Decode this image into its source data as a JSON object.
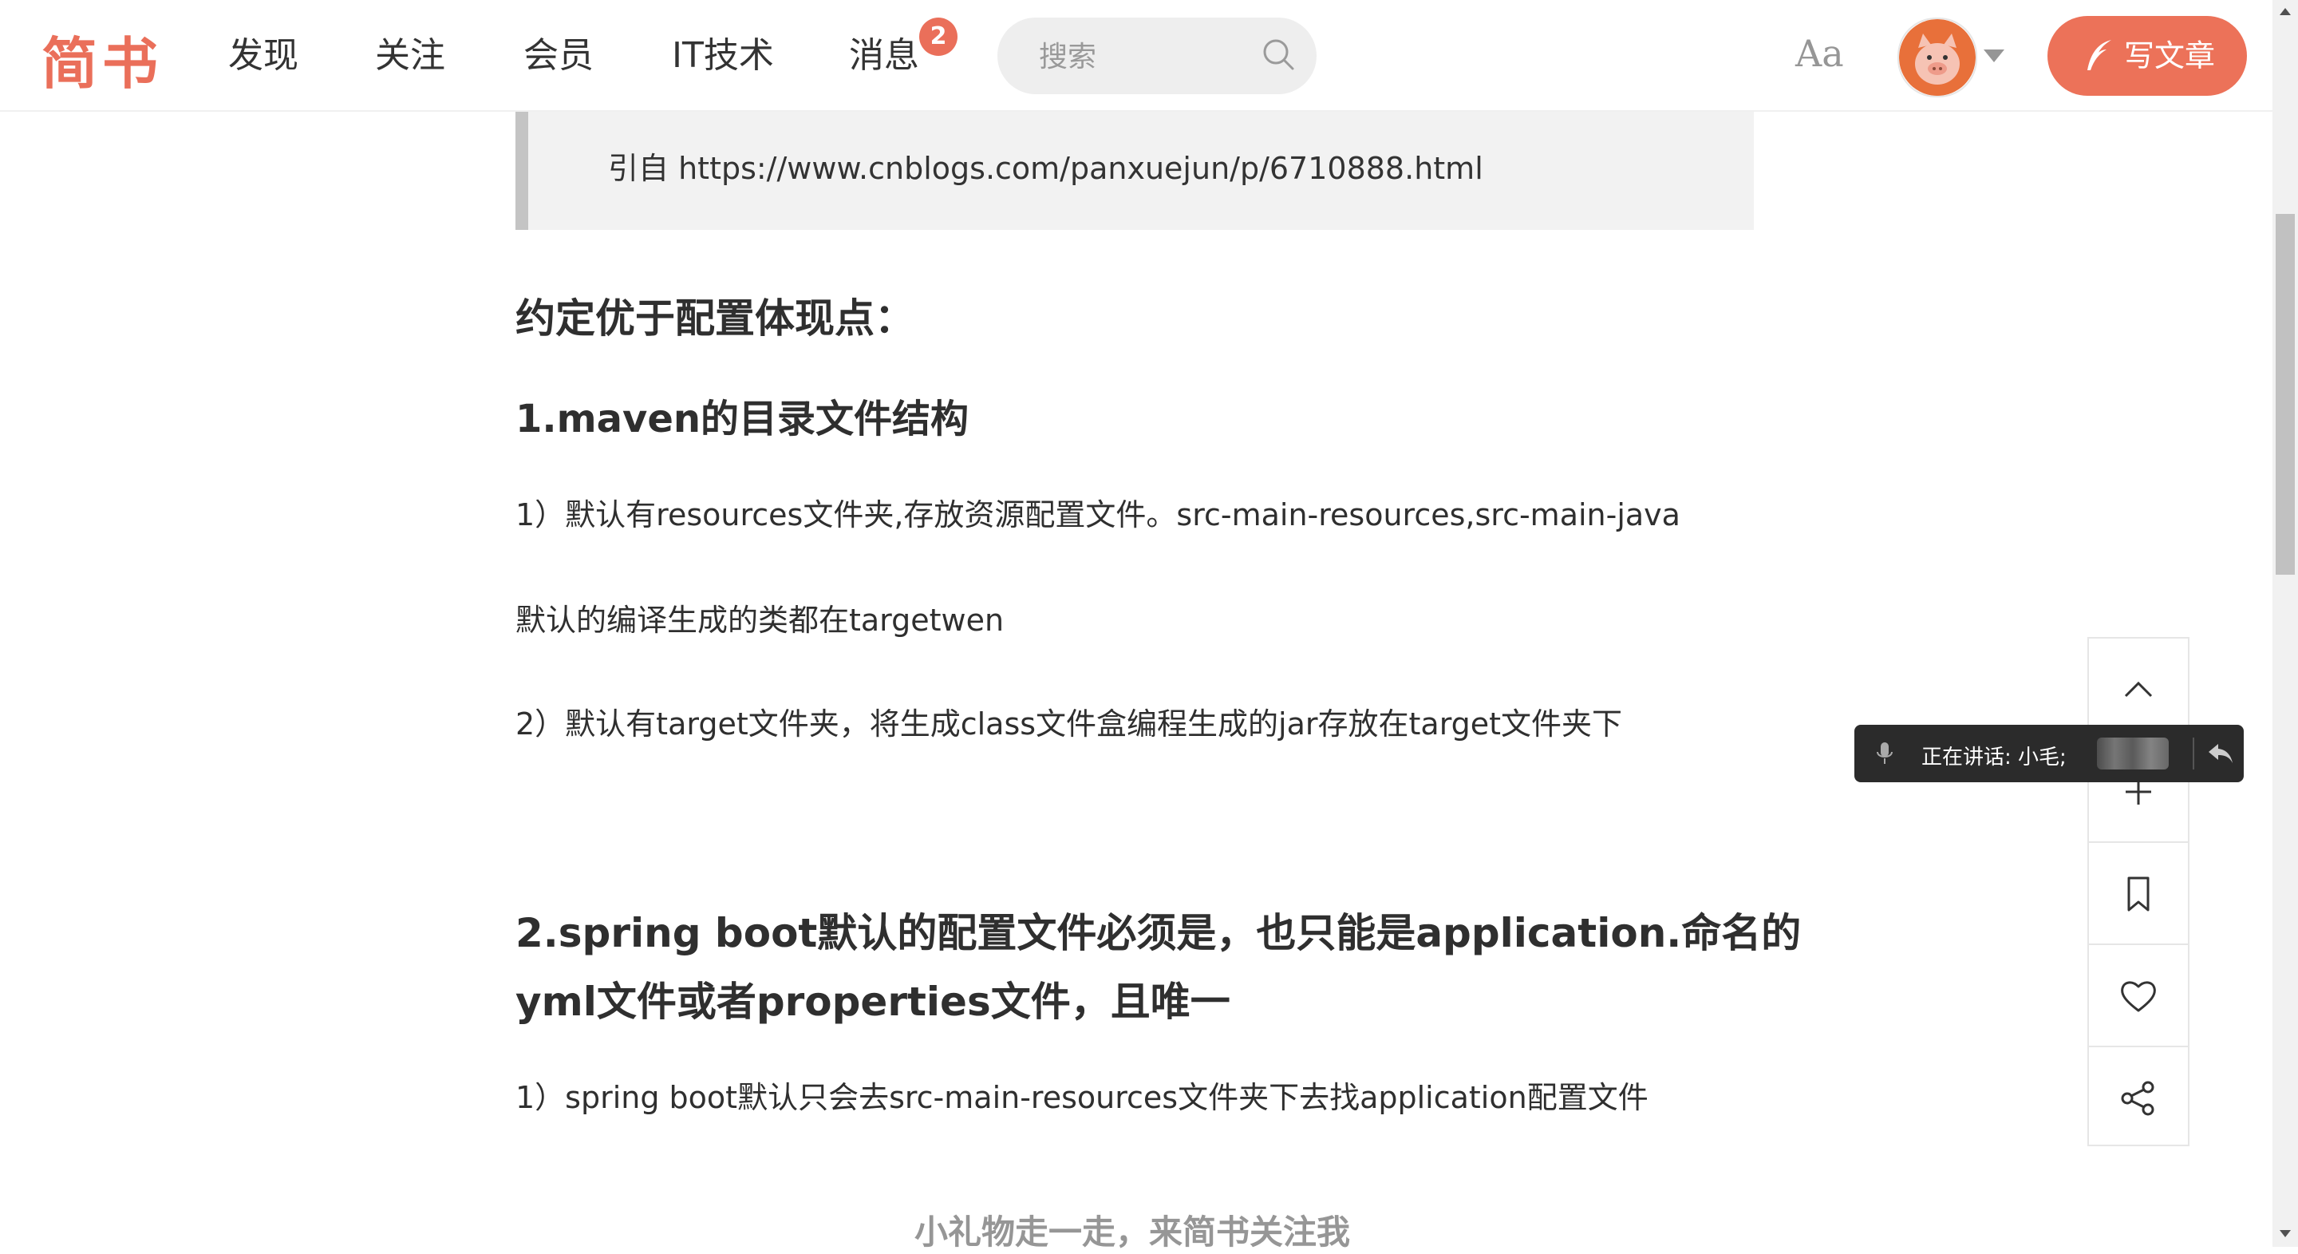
{
  "nav": {
    "logo": "简书",
    "links": [
      "发现",
      "关注",
      "会员",
      "IT技术",
      "消息"
    ],
    "message_badge": "2",
    "search_placeholder": "搜索",
    "font_toggle": "Aa",
    "write_label": "写文章",
    "accent": "#ea6f5a"
  },
  "article": {
    "quote": "引自 https://www.cnblogs.com/panxuejun/p/6710888.html",
    "heading_main": "约定优于配置体现点：",
    "section1_title": "1.maven的目录文件结构",
    "s1_p1": "1）默认有resources文件夹,存放资源配置文件。src-main-resources,src-main-java",
    "s1_p2": "默认的编译生成的类都在targetwen",
    "s1_p3": "2）默认有target文件夹，将生成class文件盒编程生成的jar存放在target文件夹下",
    "section2_line1": "2.spring boot默认的配置文件必须是，也只能是application.命名的",
    "section2_line2": "yml文件或者properties文件，且唯一",
    "s2_p1": "1）spring boot默认只会去src-main-resources文件夹下去找application配置文件",
    "gift_text": "小礼物走一走，来简书关注我"
  },
  "side_toolbar": {
    "icons": [
      "chevron-up-icon",
      "plus-icon",
      "bookmark-icon",
      "heart-icon",
      "share-icon"
    ]
  },
  "speaking": {
    "label": "正在讲话: 小毛;"
  }
}
